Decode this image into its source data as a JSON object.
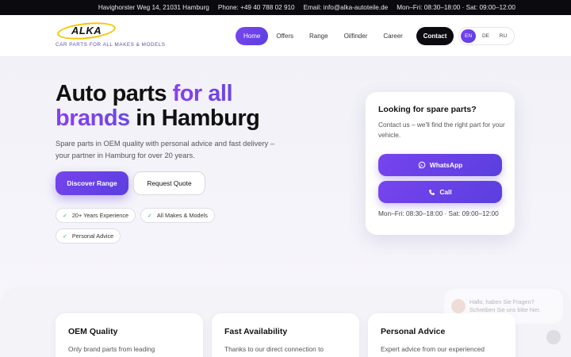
{
  "topbar": {
    "address": "Havighorster Weg 14, 21031 Hamburg",
    "phone": "Phone:  +49 40 788 02 910",
    "email": "Email:  info@alka-autoteile.de",
    "hours": "Mon–Fri: 08:30–18:00 · Sat: 09:00–12:00"
  },
  "logo": {
    "name": "ALKA",
    "tagline": "CAR PARTS FOR ALL MAKES & MODELS"
  },
  "nav": {
    "items": [
      {
        "label": "Home",
        "active": true
      },
      {
        "label": "Offers"
      },
      {
        "label": "Range"
      },
      {
        "label": "Oilfinder"
      },
      {
        "label": "Career"
      }
    ],
    "contact": "Contact",
    "languages": [
      {
        "label": "EN",
        "active": true
      },
      {
        "label": "DE"
      },
      {
        "label": "RU"
      }
    ]
  },
  "hero": {
    "title_part1": "Auto parts ",
    "title_accent1": "for all",
    "title_accent2": "brands",
    "title_part2": " in Hamburg",
    "subtitle": "Spare parts in OEM quality with personal advice and fast delivery – your partner in Hamburg for over 20 years.",
    "primary_button": "Discover Range",
    "secondary_button": "Request Quote",
    "badges": [
      "20+ Years Experience",
      "All Makes & Models",
      "Personal Advice"
    ]
  },
  "contact_card": {
    "title": "Looking for spare parts?",
    "text": "Contact us – we'll find the right part for your vehicle.",
    "whatsapp": "WhatsApp",
    "call": "Call",
    "hours": "Mon–Fri: 08:30–18:00 · Sat: 09:00–12:00"
  },
  "features": [
    {
      "title": "OEM Quality",
      "text": "Only brand parts from leading"
    },
    {
      "title": "Fast Availability",
      "text": "Thanks to our direct connection to"
    },
    {
      "title": "Personal Advice",
      "text": "Expert advice from our experienced"
    }
  ],
  "chat": {
    "line1": "Hallo, haben Sie Fragen?",
    "line2": "Schreiben Sie uns bitte hier."
  },
  "colors": {
    "accent": "#6a46e6",
    "accent_light": "#8a3ff0",
    "dark": "#0b0b10",
    "check": "#2bb05b",
    "logo_ring": "#f2c700"
  }
}
